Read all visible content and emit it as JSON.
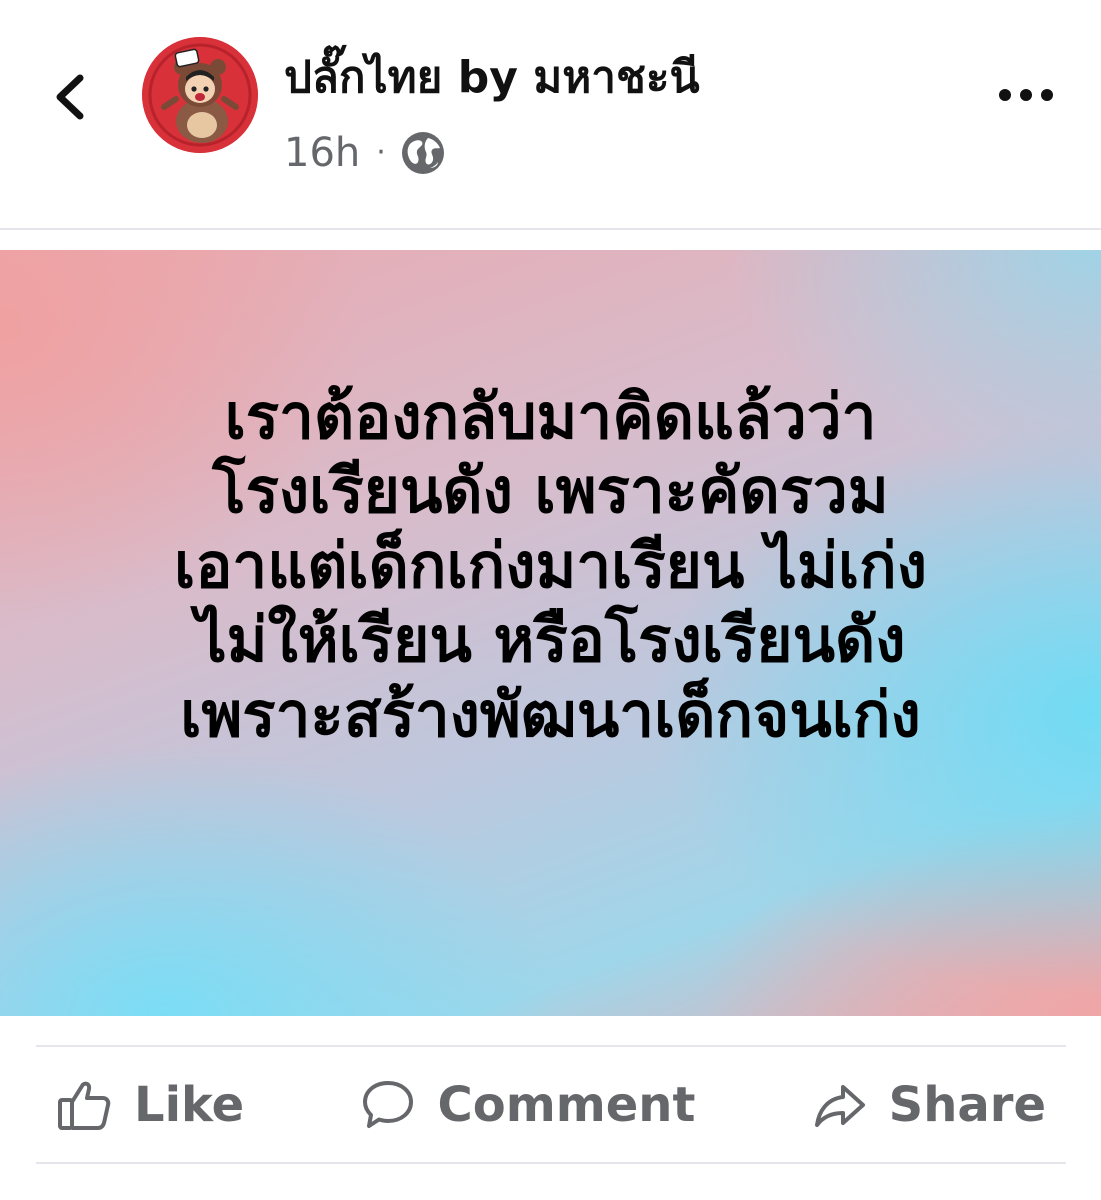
{
  "header": {
    "page_name": "ปลั๊กไทย by มหาชะนี",
    "timestamp": "16h",
    "separator": "·",
    "audience_icon": "globe-icon",
    "back_icon": "chevron-left-icon",
    "more_icon": "more-horizontal-icon",
    "avatar_color": "#d8313a"
  },
  "post": {
    "lines": [
      "เราต้องกลับมาคิดแล้วว่า",
      "โรงเรียนดัง เพราะคัดรวม",
      "เอาแต่เด็กเก่งมาเรียน ไม่เก่ง",
      "ไม่ให้เรียน หรือโรงเรียนดัง",
      "เพราะสร้างพัฒนาเด็กจนเก่ง"
    ],
    "background_colors": [
      "#f0a0a0",
      "#6edcf5",
      "#d8bccb"
    ]
  },
  "actions": {
    "like": {
      "label": "Like",
      "icon": "thumbs-up-icon"
    },
    "comment": {
      "label": "Comment",
      "icon": "comment-icon"
    },
    "share": {
      "label": "Share",
      "icon": "share-icon"
    },
    "text_color": "#65676b"
  }
}
